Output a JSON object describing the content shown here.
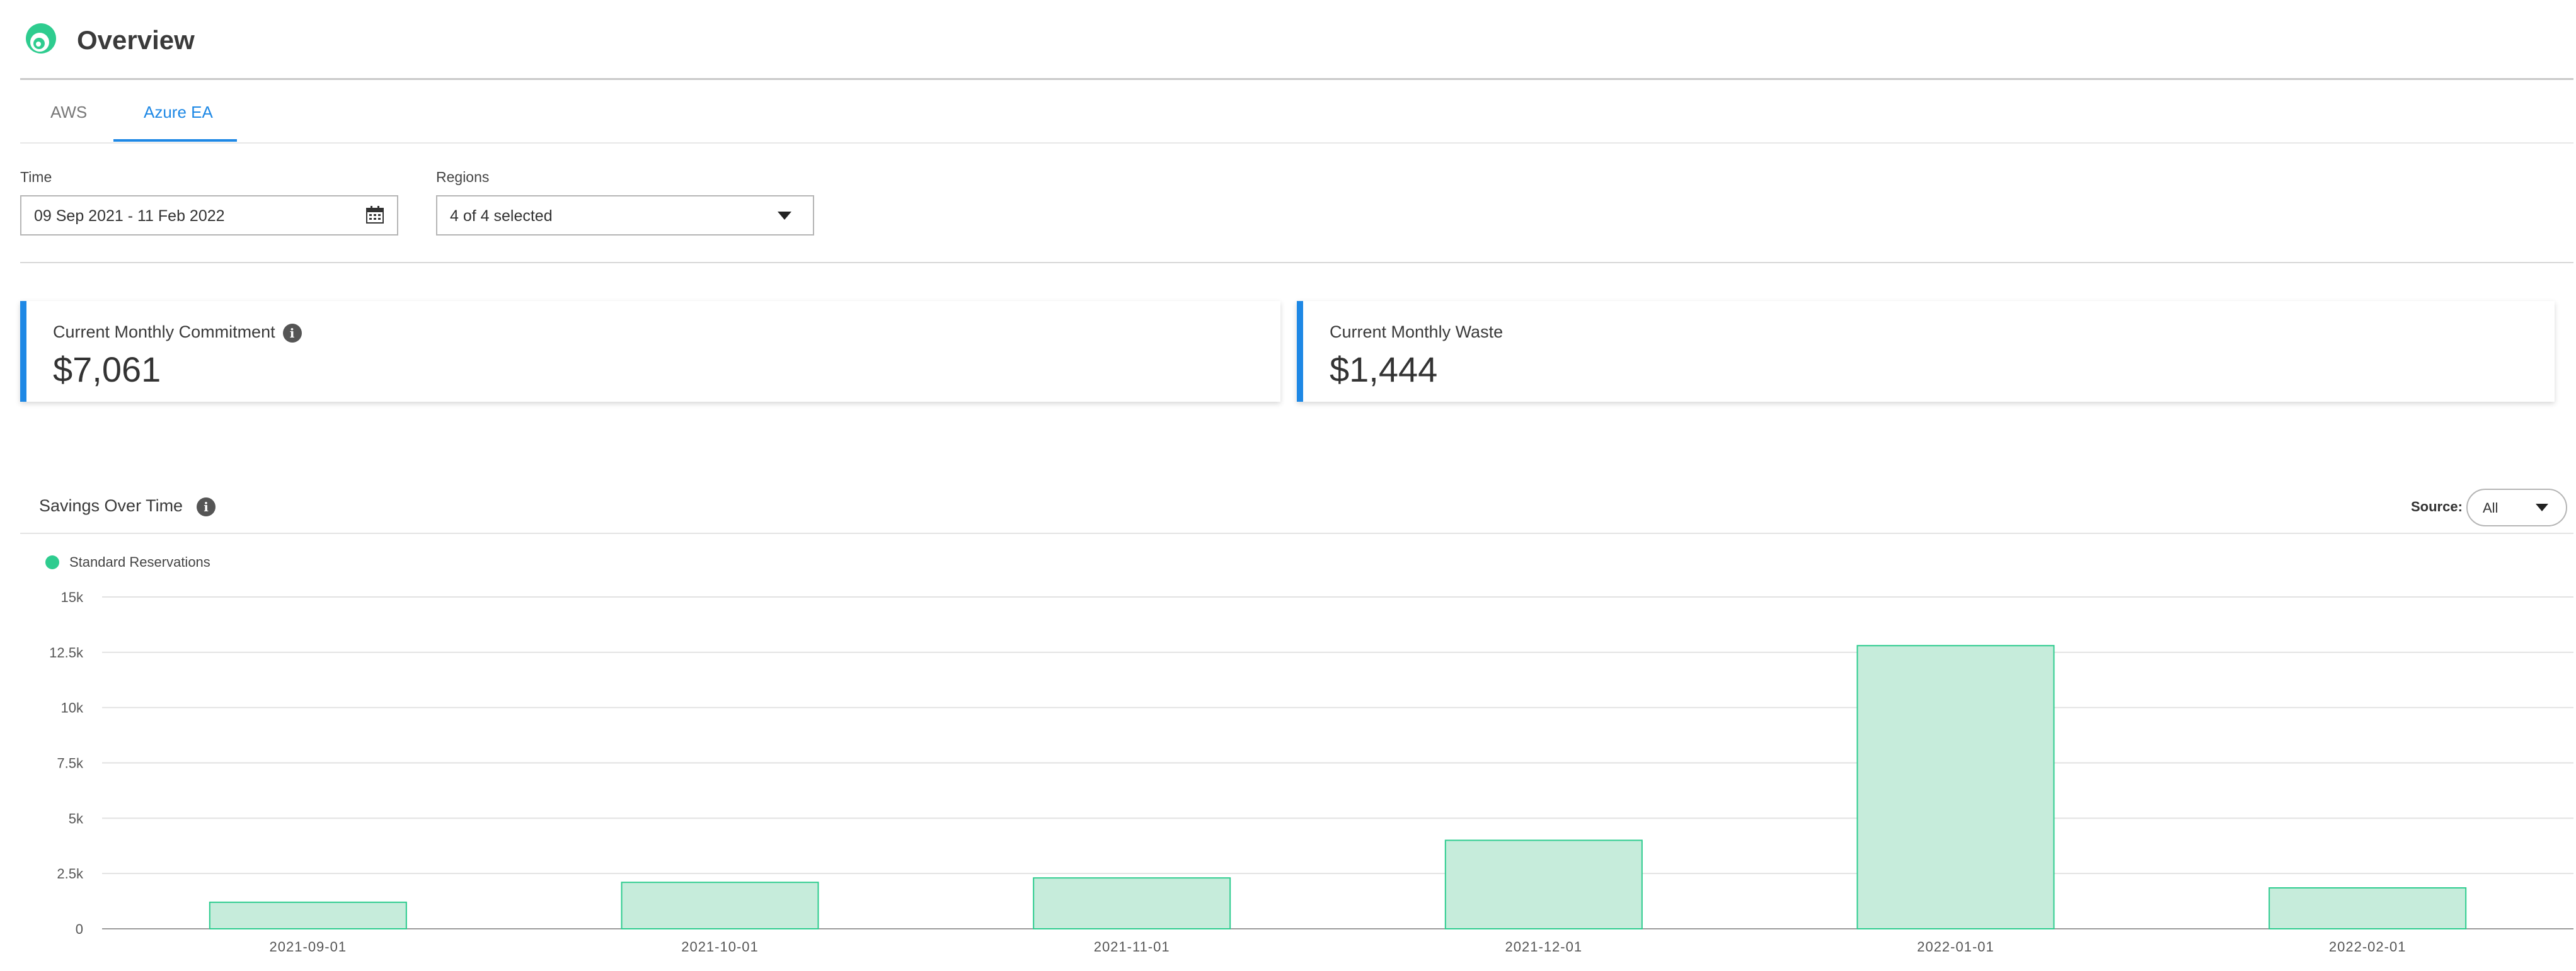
{
  "header": {
    "title": "Overview",
    "logo_icon": "cloud-logo-icon"
  },
  "tabs": [
    {
      "label": "AWS",
      "active": false
    },
    {
      "label": "Azure EA",
      "active": true
    }
  ],
  "filters": {
    "time_label": "Time",
    "time_value": "09 Sep 2021 - 11 Feb 2022",
    "regions_label": "Regions",
    "regions_value": "4 of 4 selected"
  },
  "cards": [
    {
      "label": "Current Monthly Commitment",
      "value": "$7,061",
      "has_info": true
    },
    {
      "label": "Current Monthly Waste",
      "value": "$1,444",
      "has_info": false
    }
  ],
  "savings": {
    "title": "Savings Over Time",
    "source_label": "Source:",
    "source_value": "All"
  },
  "colors": {
    "accent": "#1e88e5",
    "bar_fill": "#c6ecdb",
    "bar_stroke": "#2ecc8f"
  },
  "chart_data": {
    "type": "bar",
    "categories": [
      "2021-09-01",
      "2021-10-01",
      "2021-11-01",
      "2021-12-01",
      "2022-01-01",
      "2022-02-01"
    ],
    "series": [
      {
        "name": "Standard Reservations",
        "values": [
          1200,
          2100,
          2300,
          4000,
          12800,
          1850
        ]
      }
    ],
    "ylim": [
      0,
      15000
    ],
    "yticks": [
      0,
      2500,
      5000,
      7500,
      10000,
      12500,
      15000
    ],
    "ytick_labels": [
      "0",
      "2.5k",
      "5k",
      "7.5k",
      "10k",
      "12.5k",
      "15k"
    ],
    "grid": true,
    "legend": "top-left"
  }
}
